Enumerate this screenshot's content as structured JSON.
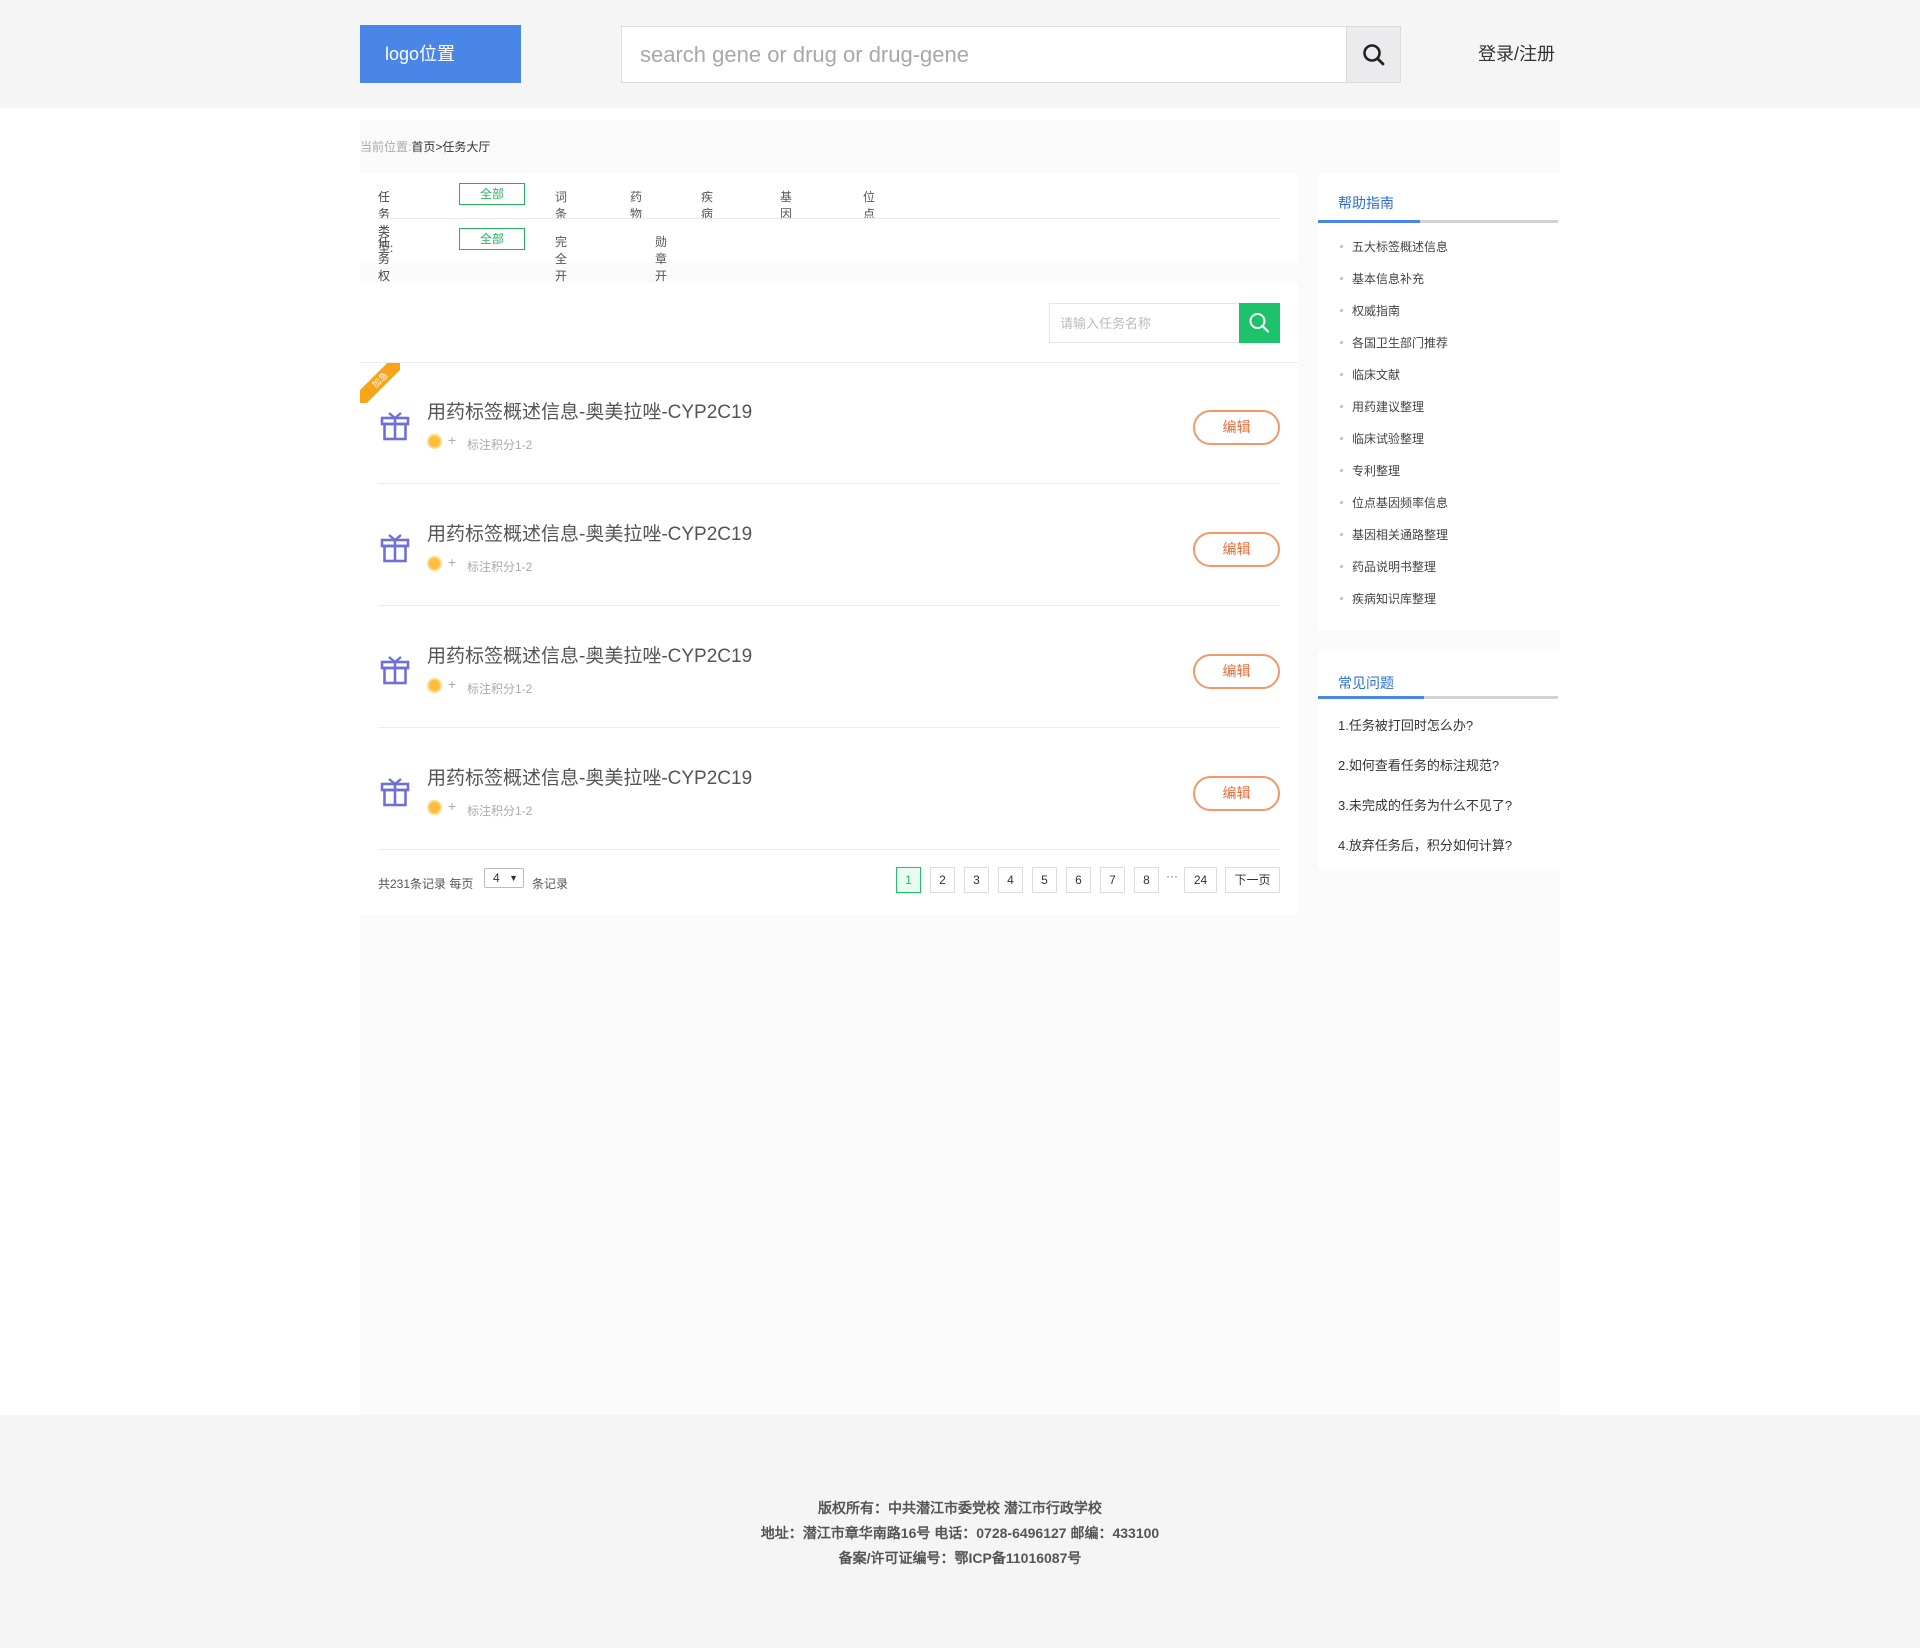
{
  "header": {
    "logo": "logo位置",
    "search_placeholder": "search gene or drug or drug-gene",
    "login": "登录/注册"
  },
  "breadcrumb": {
    "prefix": "当前位置:",
    "path": "首页>任务大厅"
  },
  "filters": {
    "type": {
      "label": "任务类型:",
      "options": [
        "全部",
        "词条",
        "药物",
        "疾病",
        "基因",
        "位点"
      ]
    },
    "permission": {
      "label": "任务权限:",
      "options": [
        "全部",
        "完全开放",
        "勋章开放"
      ]
    }
  },
  "task_search": {
    "placeholder": "请输入任务名称"
  },
  "ribbon_label": "加急",
  "tasks": [
    {
      "title": "用药标签概述信息-奥美拉唑-CYP2C19",
      "plus": "+",
      "points": "标注积分1-2",
      "action": "编辑"
    },
    {
      "title": "用药标签概述信息-奥美拉唑-CYP2C19",
      "plus": "+",
      "points": "标注积分1-2",
      "action": "编辑"
    },
    {
      "title": "用药标签概述信息-奥美拉唑-CYP2C19",
      "plus": "+",
      "points": "标注积分1-2",
      "action": "编辑"
    },
    {
      "title": "用药标签概述信息-奥美拉唑-CYP2C19",
      "plus": "+",
      "points": "标注积分1-2",
      "action": "编辑"
    }
  ],
  "pagination": {
    "total_text": "共231条记录 每页",
    "per_page": "4",
    "unit": "条记录",
    "pages": [
      "1",
      "2",
      "3",
      "4",
      "5",
      "6",
      "7",
      "8"
    ],
    "ellipsis": "···",
    "last": "24",
    "next": "下一页",
    "current": "1"
  },
  "help": {
    "title": "帮助指南",
    "items": [
      "五大标签概述信息",
      "基本信息补充",
      "权威指南",
      "各国卫生部门推荐",
      "临床文献",
      "用药建议整理",
      "临床试验整理",
      "专利整理",
      "位点基因频率信息",
      "基因相关通路整理",
      "药品说明书整理",
      "疾病知识库整理"
    ]
  },
  "faq": {
    "title": "常见问题",
    "items": [
      "1.任务被打回时怎么办?",
      "2.如何查看任务的标注规范?",
      "3.未完成的任务为什么不见了?",
      "4.放弃任务后，积分如何计算?"
    ]
  },
  "footer": {
    "line1": "版权所有：中共潜江市委党校 潜江市行政学校",
    "line2": "地址：潜江市章华南路16号 电话：0728-6496127 邮编：433100",
    "line3": "备案/许可证编号：鄂ICP备11016087号"
  },
  "colors": {
    "accent_blue": "#4a86e8",
    "accent_green": "#1dc36a",
    "edit_orange": "#f06b38",
    "ribbon": "#f7a31b"
  }
}
